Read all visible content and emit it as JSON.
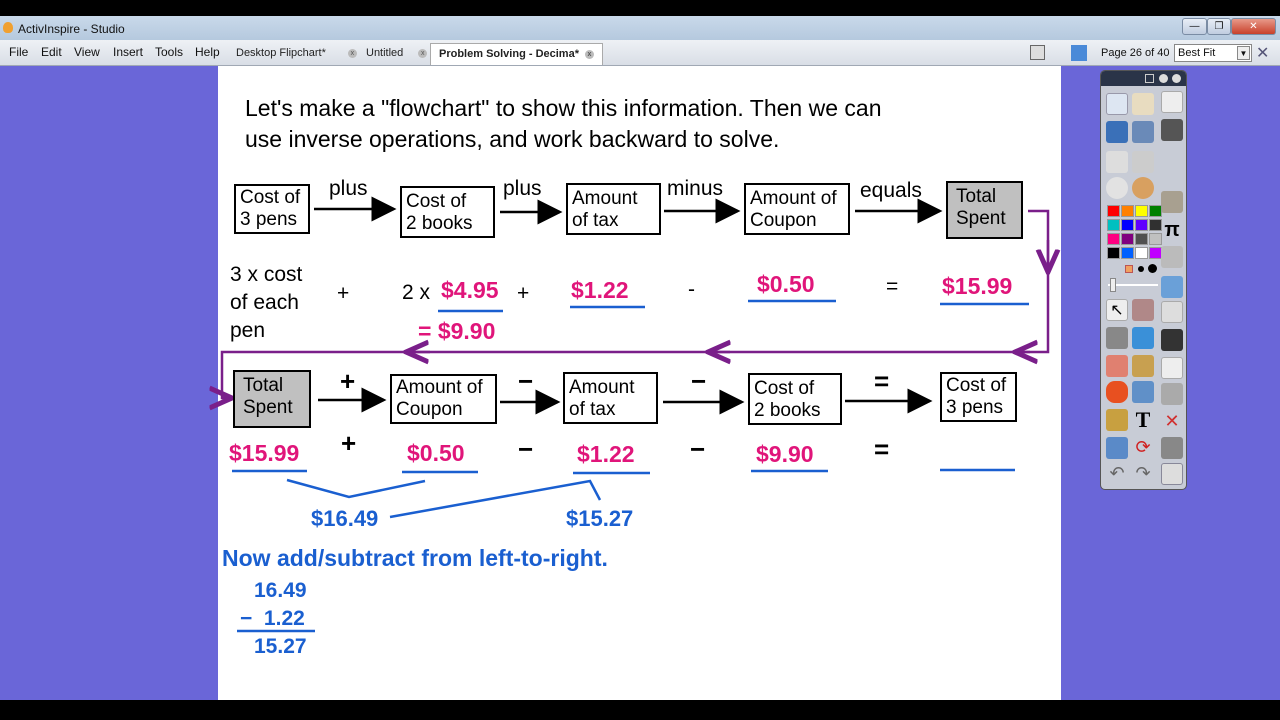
{
  "window": {
    "title": "ActivInspire - Studio",
    "min": "—",
    "max": "❐",
    "close": "✕"
  },
  "menu": [
    "File",
    "Edit",
    "View",
    "Insert",
    "Tools",
    "Help"
  ],
  "tabs": [
    {
      "label": "Desktop Flipchart*"
    },
    {
      "label": "Untitled"
    },
    {
      "label": "Problem Solving - Decima*",
      "active": true
    }
  ],
  "page_indicator": "Page 26 of 40",
  "zoom": "Best Fit",
  "colors": {
    "pink": "#e0157a",
    "blue": "#1a5fd0",
    "purple": "#7a1f8a",
    "background": "#6a66d8"
  },
  "slide": {
    "intro": [
      "Let's make a \"flowchart\" to show this information. Then we can",
      "use inverse operations, and work backward to solve."
    ],
    "row1": {
      "boxes": [
        [
          "Cost of",
          "3 pens"
        ],
        [
          "Cost of",
          "2 books"
        ],
        [
          "Amount",
          "of tax"
        ],
        [
          "Amount of",
          "Coupon"
        ],
        [
          "Total",
          "Spent"
        ]
      ],
      "ops": [
        "plus",
        "plus",
        "minus",
        "equals"
      ]
    },
    "row2": {
      "pens": [
        "3 x cost",
        "of each",
        "pen"
      ],
      "plus1": "+",
      "books_prefix": "2 x",
      "books_price": "$4.95",
      "plus2": "+",
      "books_total": "= $9.90",
      "tax": "$1.22",
      "minus": "-",
      "coupon": "$0.50",
      "equals": "=",
      "total": "$15.99"
    },
    "row3": {
      "boxes": [
        [
          "Total",
          "Spent"
        ],
        [
          "Amount of",
          "Coupon"
        ],
        [
          "Amount",
          "of tax"
        ],
        [
          "Cost of",
          "2 books"
        ],
        [
          "Cost of",
          "3 pens"
        ]
      ],
      "ops": [
        "+",
        "−",
        "−",
        "="
      ]
    },
    "row4": {
      "values": [
        "$15.99",
        "$0.50",
        "$1.22",
        "$9.90"
      ],
      "ops": [
        "+",
        "−",
        "−",
        "="
      ]
    },
    "sums": {
      "first": "$16.49",
      "second": "$15.27"
    },
    "instruction": "Now add/subtract from left-to-right.",
    "work": {
      "line1": "16.49",
      "line2": "−  1.22",
      "line3": "15.27"
    }
  },
  "toolbox": {
    "palette": [
      "#ff0000",
      "#ff8000",
      "#ffff00",
      "#008000",
      "#00c0c0",
      "#0000ff",
      "#6000ff",
      "#303030",
      "#ff0080",
      "#800080",
      "#505050",
      "#c0c0c0",
      "#000000",
      "#0060ff",
      "#ffffff",
      "#c000ff"
    ]
  }
}
